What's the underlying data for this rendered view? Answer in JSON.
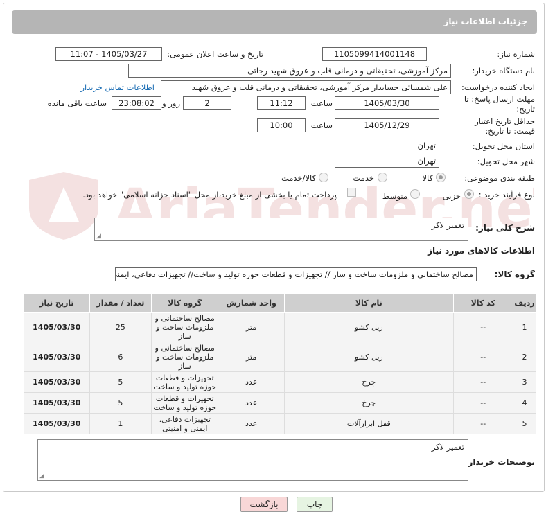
{
  "header": {
    "title": "جزئیات اطلاعات نیاز"
  },
  "fields": {
    "need_number_label": "شماره نیاز:",
    "need_number": "1105099414001148",
    "announce_label": "تاریخ و ساعت اعلان عمومی:",
    "announce_value": "1405/03/27 - 11:07",
    "buyer_org_label": "نام دستگاه خریدار:",
    "buyer_org": "مرکز آموزشی، تحقیقاتی و درمانی قلب و عروق شهید رجائی",
    "creator_label": "ایجاد کننده درخواست:",
    "creator": "علی شمسائی حسابدار مرکز آموزشی، تحقیقاتی و درمانی قلب و عروق شهید",
    "contact_link": "اطلاعات تماس خریدار",
    "deadline_label": "مهلت ارسال پاسخ: تا تاریخ:",
    "deadline_date": "1405/03/30",
    "time_label": "ساعت",
    "deadline_time": "11:12",
    "days_value": "2",
    "days_label": "روز و",
    "remaining_time": "23:08:02",
    "remaining_label": "ساعت باقی مانده",
    "validity_label": "حداقل تاریخ اعتبار قیمت: تا تاریخ:",
    "validity_date": "1405/12/29",
    "validity_time": "10:00",
    "province_label": "استان محل تحویل:",
    "province": "تهران",
    "city_label": "شهر محل تحویل:",
    "city": "تهران",
    "category_label": "طبقه بندی موضوعی:",
    "category_options": [
      "کالا",
      "خدمت",
      "کالا/خدمت"
    ],
    "category_selected": "کالا",
    "process_label": "نوع فرآیند خرید :",
    "process_options": [
      "جزیی",
      "متوسط"
    ],
    "process_selected": "جزیی",
    "payment_note": "پرداخت تمام یا بخشی از مبلغ خرید،از محل \"اسناد خزانه اسلامی\" خواهد بود."
  },
  "description": {
    "label": "شرح کلی نیاز:",
    "value": "تعمیر لاکر"
  },
  "goods_info": {
    "title": "اطلاعات کالاهای مورد نیاز"
  },
  "goods_group": {
    "label": "گروه کالا:",
    "value": "مصالح ساختمانی و ملزومات ساخت و ساز // تجهیزات و قطعات حوزه تولید و ساخت// تجهیزات دفاعی، ایمنی"
  },
  "table": {
    "headers": [
      "ردیف",
      "کد کالا",
      "نام کالا",
      "واحد شمارش",
      "گروه کالا",
      "تعداد / مقدار",
      "تاریخ نیاز"
    ],
    "rows": [
      {
        "idx": "1",
        "code": "--",
        "name": "ریل کشو",
        "unit": "متر",
        "group": "مصالح ساختمانی و ملزومات ساخت و ساز",
        "qty": "25",
        "date": "1405/03/30"
      },
      {
        "idx": "2",
        "code": "--",
        "name": "ریل کشو",
        "unit": "متر",
        "group": "مصالح ساختمانی و ملزومات ساخت و ساز",
        "qty": "6",
        "date": "1405/03/30"
      },
      {
        "idx": "3",
        "code": "--",
        "name": "چرخ",
        "unit": "عدد",
        "group": "تجهیزات و قطعات حوزه تولید و ساخت",
        "qty": "5",
        "date": "1405/03/30"
      },
      {
        "idx": "4",
        "code": "--",
        "name": "چرخ",
        "unit": "عدد",
        "group": "تجهیزات و قطعات حوزه تولید و ساخت",
        "qty": "5",
        "date": "1405/03/30"
      },
      {
        "idx": "5",
        "code": "--",
        "name": "قفل ابزارآلات",
        "unit": "عدد",
        "group": "تجهیزات دفاعی، ایمنی و امنیتی",
        "qty": "1",
        "date": "1405/03/30"
      }
    ]
  },
  "buyer_notes": {
    "label": "توضیحات خریدار:",
    "value": "تعمیر لاکر"
  },
  "buttons": {
    "print": "چاپ",
    "back": "بازگشت"
  },
  "watermark": {
    "text": "AriaTender.neT"
  },
  "colors": {
    "header_bg": "#b5b5b5",
    "link": "#1e6fb5",
    "back_button_bg": "#f8d7d7",
    "print_button_bg": "#e6f4e2"
  }
}
